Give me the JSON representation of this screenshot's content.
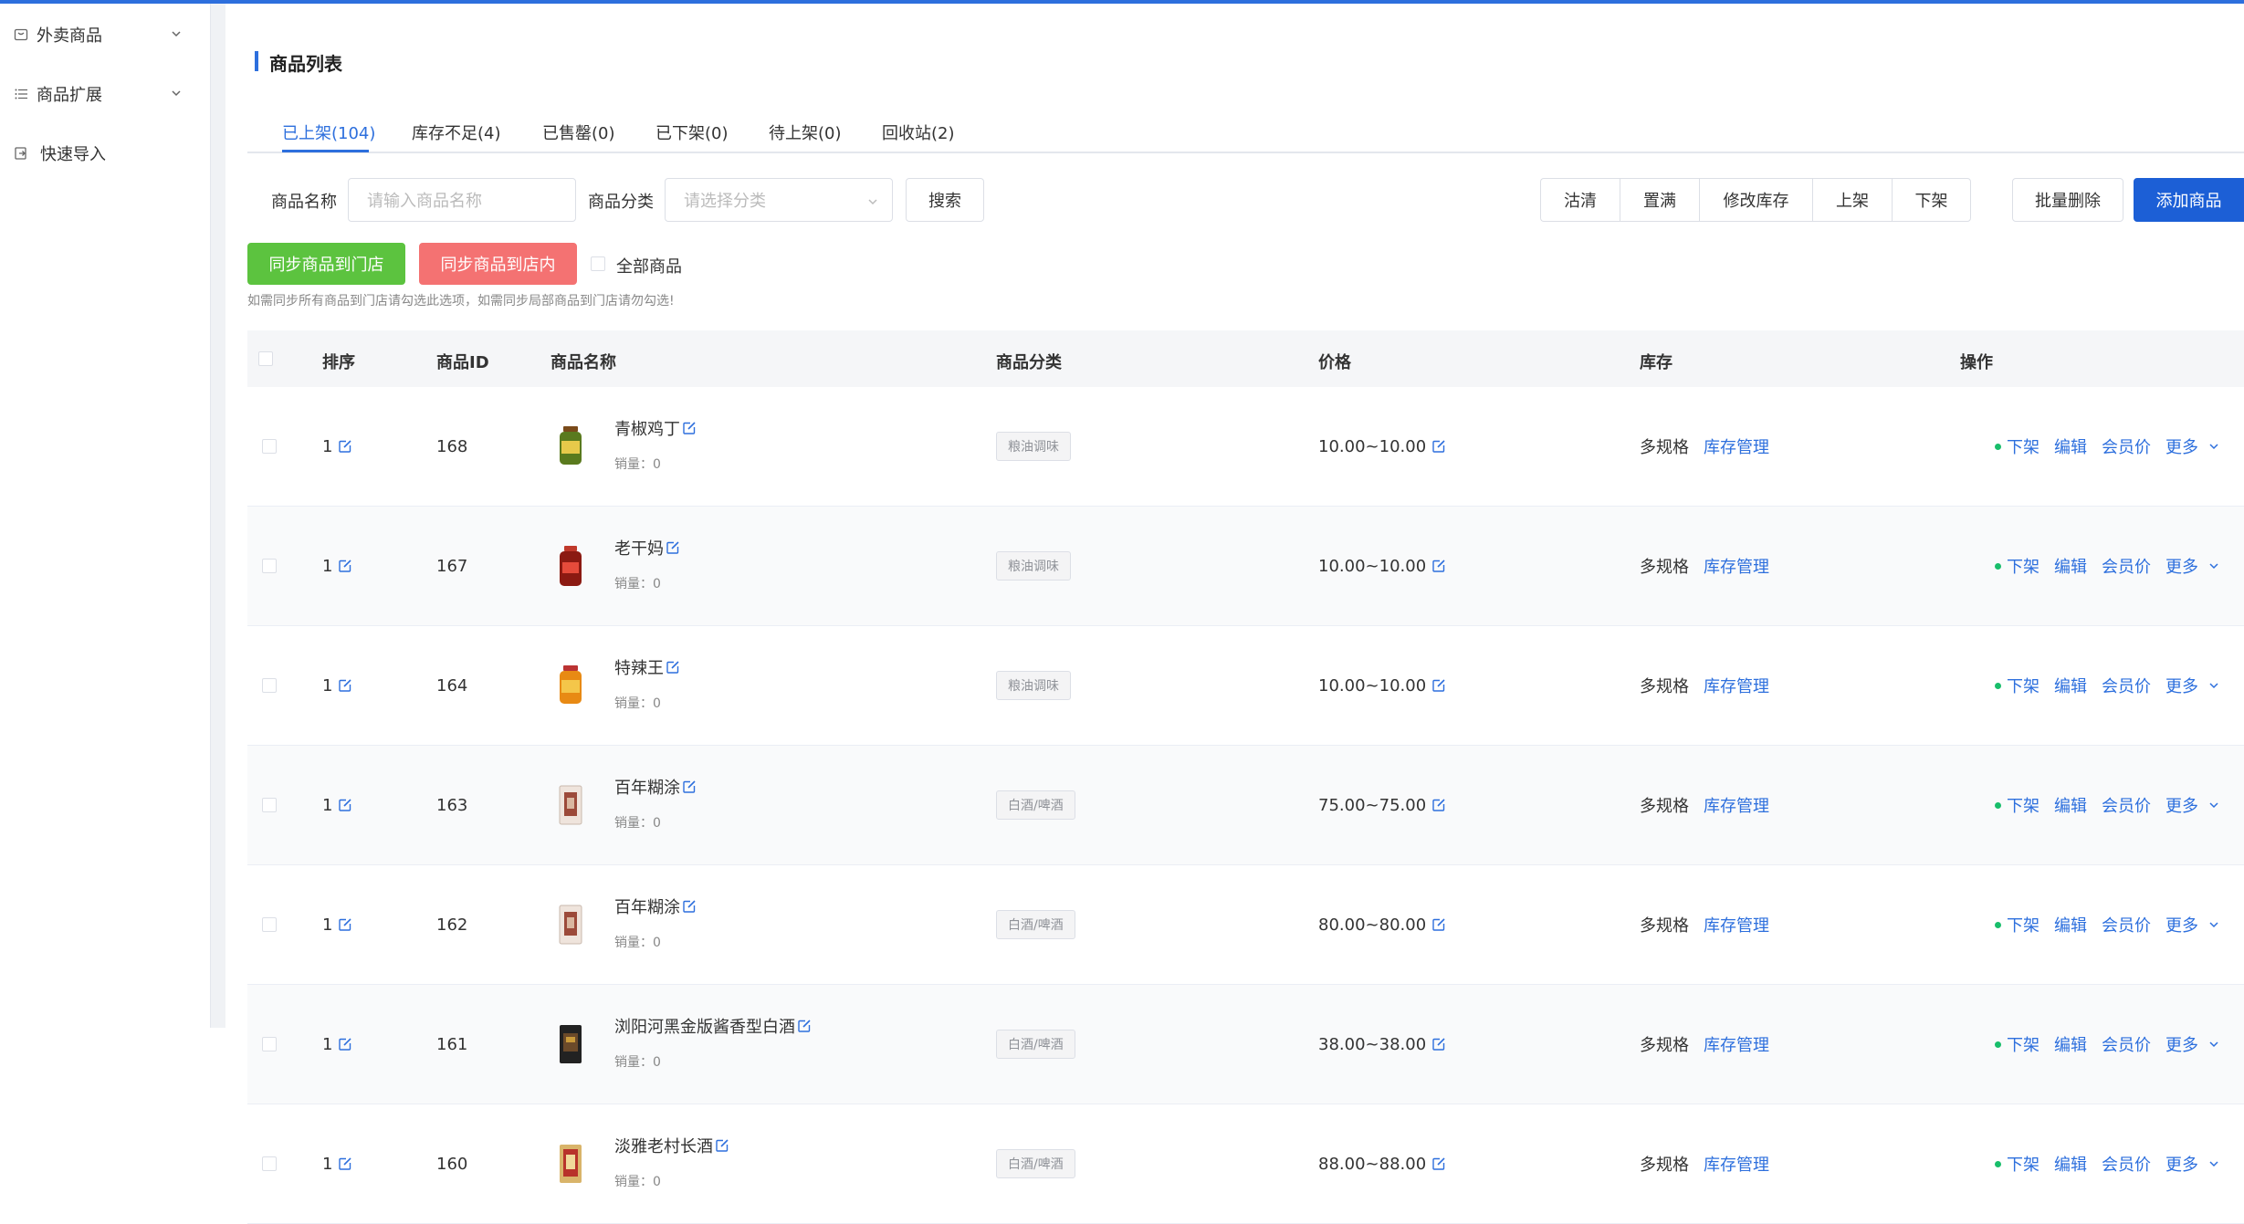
{
  "sidebar": {
    "items": [
      {
        "label": "外卖商品",
        "icon": "shop-icon",
        "has_children": true
      },
      {
        "label": "商品扩展",
        "icon": "list-icon",
        "has_children": true
      },
      {
        "label": "快速导入",
        "icon": "import-icon",
        "has_children": false
      }
    ]
  },
  "page": {
    "title": "商品列表",
    "accent_color": "#2d6fdd"
  },
  "tabs": [
    {
      "label": "已上架(104)",
      "active": true
    },
    {
      "label": "库存不足(4)",
      "active": false
    },
    {
      "label": "已售罄(0)",
      "active": false
    },
    {
      "label": "已下架(0)",
      "active": false
    },
    {
      "label": "待上架(0)",
      "active": false
    },
    {
      "label": "回收站(2)",
      "active": false
    }
  ],
  "filters": {
    "name_label": "商品名称",
    "name_placeholder": "请输入商品名称",
    "category_label": "商品分类",
    "category_placeholder": "请选择分类",
    "search_button": "搜索"
  },
  "toolbar": {
    "group": [
      "沽清",
      "置满",
      "修改库存",
      "上架",
      "下架"
    ],
    "batch_delete": "批量删除",
    "add_product": "添加商品"
  },
  "sync": {
    "to_store_button": "同步商品到门店",
    "to_shop_button": "同步商品到店内",
    "all_products_label": "全部商品",
    "hint": "如需同步所有商品到门店请勾选此选项，如需同步局部商品到门店请勿勾选!"
  },
  "table": {
    "headers": [
      "排序",
      "商品ID",
      "商品名称",
      "商品分类",
      "价格",
      "库存",
      "操作"
    ],
    "sales_prefix": "销量：",
    "stock_text": "多规格",
    "stock_link": "库存管理",
    "ops": {
      "status": "下架",
      "edit": "编辑",
      "member_price": "会员价",
      "more": "更多"
    },
    "rows": [
      {
        "sort": "1",
        "id": "168",
        "name": "青椒鸡丁",
        "sales": "0",
        "category": "粮油调味",
        "price": "10.00~10.00",
        "thumb": "jar-green"
      },
      {
        "sort": "1",
        "id": "167",
        "name": "老干妈",
        "sales": "0",
        "category": "粮油调味",
        "price": "10.00~10.00",
        "thumb": "jar-red"
      },
      {
        "sort": "1",
        "id": "164",
        "name": "特辣王",
        "sales": "0",
        "category": "粮油调味",
        "price": "10.00~10.00",
        "thumb": "jar-orange"
      },
      {
        "sort": "1",
        "id": "163",
        "name": "百年糊涂",
        "sales": "0",
        "category": "白酒/啤酒",
        "price": "75.00~75.00",
        "thumb": "box-brown"
      },
      {
        "sort": "1",
        "id": "162",
        "name": "百年糊涂",
        "sales": "0",
        "category": "白酒/啤酒",
        "price": "80.00~80.00",
        "thumb": "box-brown"
      },
      {
        "sort": "1",
        "id": "161",
        "name": "浏阳河黑金版酱香型白酒",
        "sales": "0",
        "category": "白酒/啤酒",
        "price": "38.00~38.00",
        "thumb": "box-black"
      },
      {
        "sort": "1",
        "id": "160",
        "name": "淡雅老村长酒",
        "sales": "0",
        "category": "白酒/啤酒",
        "price": "88.00~88.00",
        "thumb": "box-gold"
      }
    ]
  }
}
